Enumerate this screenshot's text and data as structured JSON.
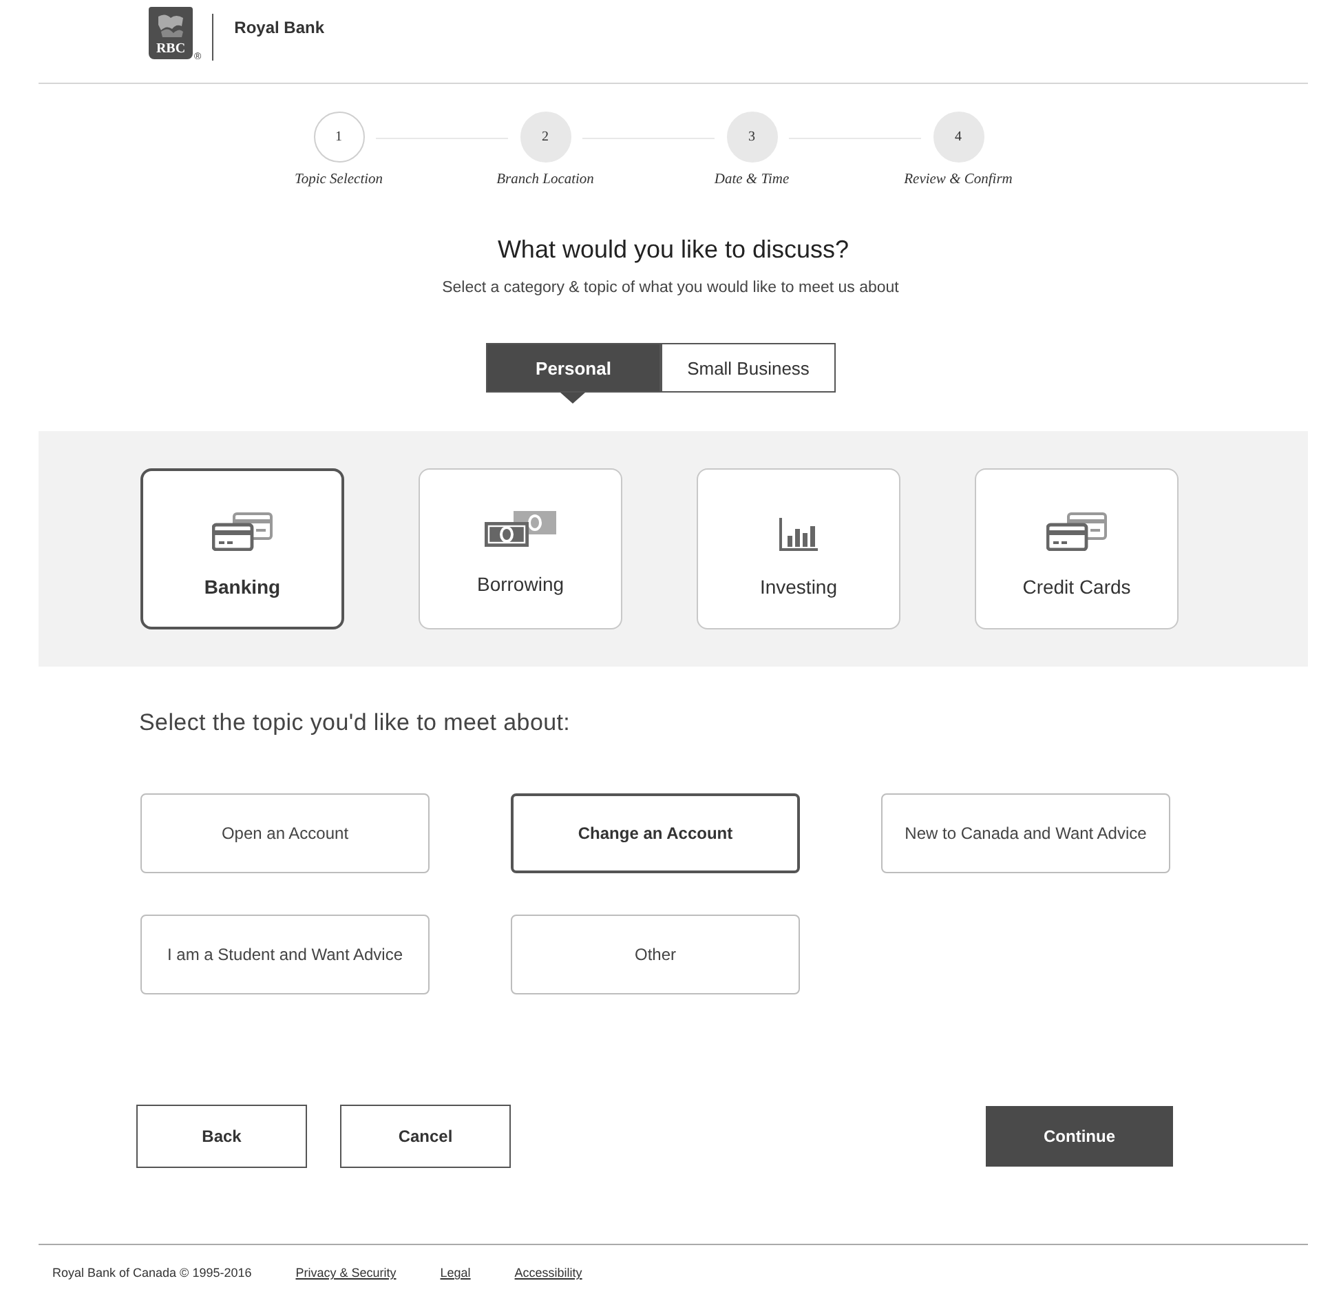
{
  "header": {
    "logo_text": "RBC",
    "logo_mark": "®",
    "brand": "Royal Bank"
  },
  "steps": [
    {
      "number": "1",
      "label": "Topic Selection",
      "current": true
    },
    {
      "number": "2",
      "label": "Branch Location",
      "current": false
    },
    {
      "number": "3",
      "label": "Date & Time",
      "current": false
    },
    {
      "number": "4",
      "label": "Review & Confirm",
      "current": false
    }
  ],
  "heading": "What would you like to discuss?",
  "subheading": "Select a category & topic of what you would like to meet us about",
  "segments": [
    {
      "label": "Personal",
      "selected": true
    },
    {
      "label": "Small Business",
      "selected": false
    }
  ],
  "categories": [
    {
      "label": "Banking",
      "kind": "cards",
      "selected": true
    },
    {
      "label": "Borrowing",
      "kind": "bills",
      "selected": false
    },
    {
      "label": "Investing",
      "kind": "chart",
      "selected": false
    },
    {
      "label": "Credit Cards",
      "kind": "cards",
      "selected": false
    }
  ],
  "topic_prompt": "Select the topic you'd like to meet about:",
  "topics": [
    {
      "label": "Open an Account",
      "selected": false
    },
    {
      "label": "Change an Account",
      "selected": true
    },
    {
      "label": "New to Canada and Want Advice",
      "selected": false
    },
    {
      "label": "I am a Student and Want Advice",
      "selected": false
    },
    {
      "label": "Other",
      "selected": false
    }
  ],
  "actions": [
    {
      "label": "Back",
      "kind": "secondary"
    },
    {
      "label": "Cancel",
      "kind": "secondary"
    },
    {
      "label": "Continue",
      "kind": "primary"
    }
  ],
  "footer": {
    "copyright": "Royal Bank of Canada © 1995-2016",
    "links": [
      "Privacy & Security",
      "Legal",
      "Accessibility"
    ]
  }
}
